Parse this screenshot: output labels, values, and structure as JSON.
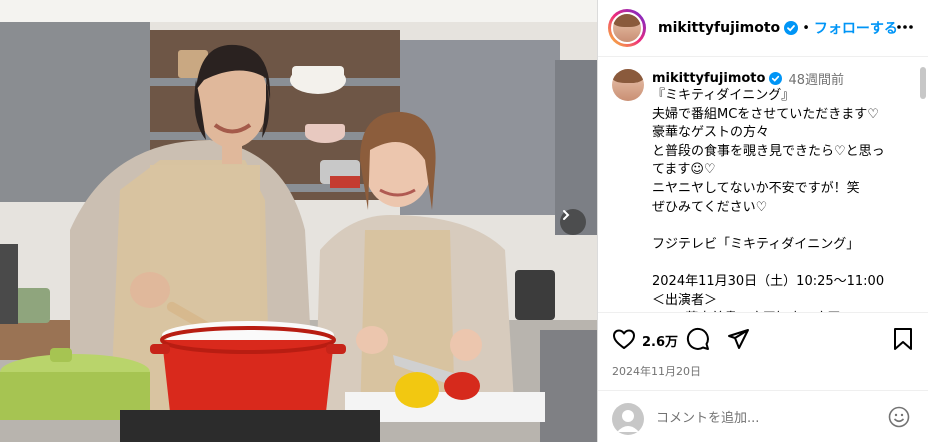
{
  "post": {
    "username": "mikittyfujimoto",
    "follow_label": "フォローする",
    "separator": "•",
    "caption_time": "48週間前",
    "caption_text": "『ミキティダイニング』\n夫婦で番組MCをさせていただきます♡\n豪華なゲストの方々\nと普段の食事を覗き見できたら♡と思ってます☺♡\nニヤニヤしてないか不安ですが！笑\nぜひみてください♡\n\nフジテレビ「ミキティダイニング」\n\n2024年11月30日（土）10:25〜11:00\n＜出演者＞\nMC：藤本美貴 / 庄司智春 / 庄司",
    "likes": "2.6万",
    "date": "2024年11月20日",
    "comment_placeholder": "コメントを追加..."
  },
  "colors": {
    "accent": "#0095f6",
    "verified": "#0095f6",
    "pot": "#d9291c",
    "pepper": "#f2c811",
    "apron": "#d8c3a0"
  },
  "icons": [
    "verified-badge-icon",
    "more-options-icon",
    "next-image-icon",
    "heart-icon",
    "comment-icon",
    "share-icon",
    "save-bookmark-icon",
    "emoji-icon"
  ]
}
